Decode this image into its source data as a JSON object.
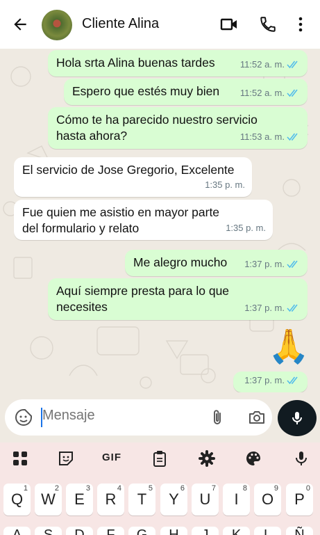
{
  "header": {
    "contact_name": "Cliente Alina",
    "icons": [
      "back-arrow-icon",
      "video-call-icon",
      "voice-call-icon",
      "more-options-icon"
    ]
  },
  "messages": [
    {
      "direction": "out",
      "text": "Hola srta Alina buenas tardes",
      "time": "11:52 a. m.",
      "status": "read"
    },
    {
      "direction": "out",
      "text": "Espero que estés muy bien",
      "time": "11:52 a. m.",
      "status": "read"
    },
    {
      "direction": "out",
      "text": "Cómo te ha parecido nuestro servicio hasta ahora?",
      "time": "11:53 a. m.",
      "status": "read"
    },
    {
      "direction": "in",
      "text": "El servicio de Jose Gregorio, Excelente",
      "time": "1:35 p. m."
    },
    {
      "direction": "in",
      "text": "Fue quien me asistio en mayor parte del formulario y relato",
      "time": "1:35 p. m."
    },
    {
      "direction": "out",
      "text": "Me alegro mucho",
      "time": "1:37 p. m.",
      "status": "read"
    },
    {
      "direction": "out",
      "text": "Aquí siempre presta para lo que necesites",
      "time": "1:37 p. m.",
      "status": "read"
    },
    {
      "direction": "out",
      "emoji": "🙏",
      "time": "1:37 p. m.",
      "status": "read"
    }
  ],
  "composer": {
    "placeholder": "Mensaje",
    "icons": [
      "sticker-icon",
      "attach-icon",
      "camera-icon",
      "mic-icon"
    ]
  },
  "keyboard": {
    "toolbar": [
      "apps-grid-icon",
      "sticker-icon",
      "GIF",
      "clipboard-icon",
      "settings-gear-icon",
      "palette-icon",
      "mic-icon"
    ],
    "row1": [
      {
        "key": "Q",
        "hint": "1"
      },
      {
        "key": "W",
        "hint": "2"
      },
      {
        "key": "E",
        "hint": "3"
      },
      {
        "key": "R",
        "hint": "4"
      },
      {
        "key": "T",
        "hint": "5"
      },
      {
        "key": "Y",
        "hint": "6"
      },
      {
        "key": "U",
        "hint": "7"
      },
      {
        "key": "I",
        "hint": "8"
      },
      {
        "key": "O",
        "hint": "9"
      },
      {
        "key": "P",
        "hint": "0"
      }
    ],
    "row2": [
      "A",
      "S",
      "D",
      "F",
      "G",
      "H",
      "J",
      "K",
      "L",
      "Ñ"
    ]
  },
  "colors": {
    "outgoing_bubble": "#d9fdd3",
    "incoming_bubble": "#ffffff",
    "chat_background": "#efeae2",
    "read_ticks": "#53bdeb",
    "keyboard_background": "#f7e6e5"
  }
}
